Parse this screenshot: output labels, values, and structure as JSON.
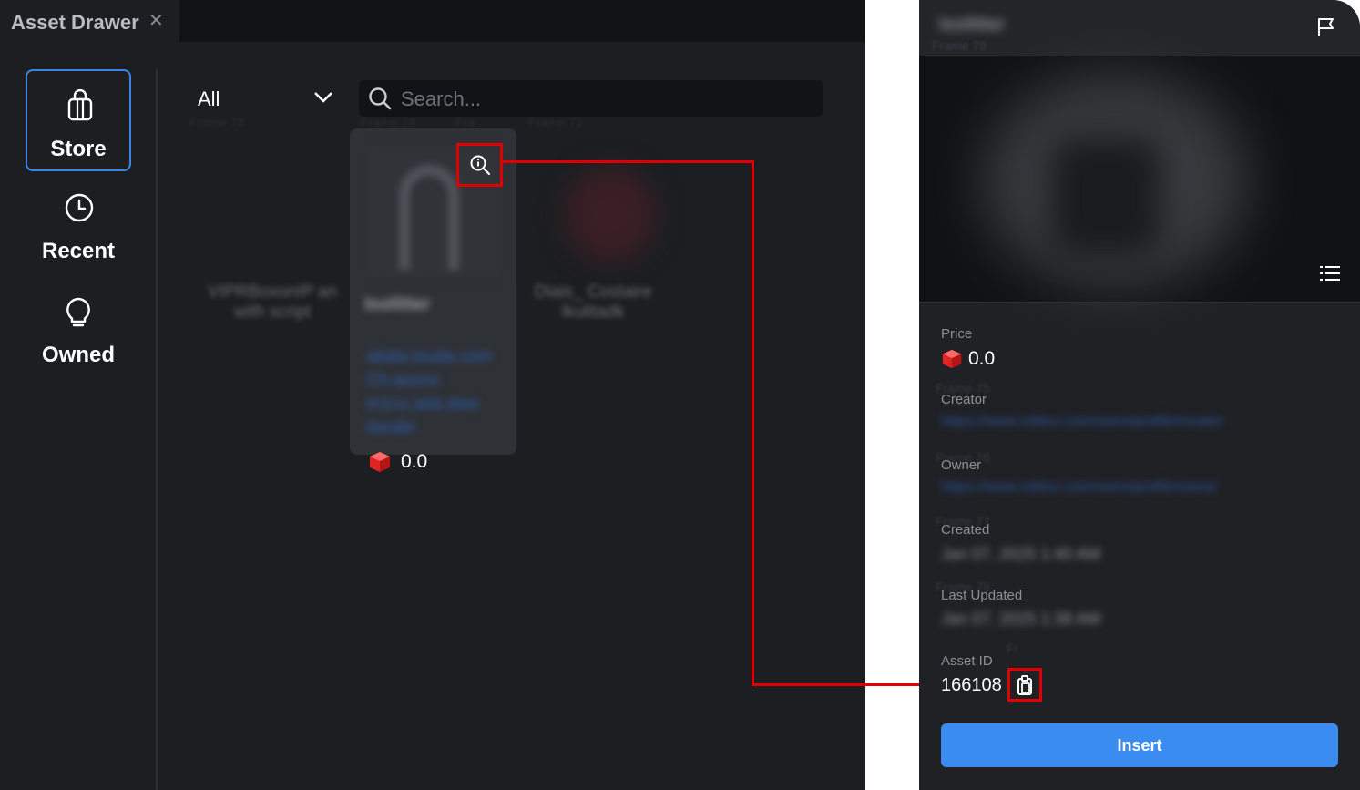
{
  "tab": {
    "title": "Asset Drawer",
    "close_glyph": "✕"
  },
  "nav": [
    {
      "label": "Store",
      "icon": "bag-icon",
      "active": true
    },
    {
      "label": "Recent",
      "icon": "clock-icon"
    },
    {
      "label": "Owned",
      "icon": "lightbulb-icon"
    }
  ],
  "filter": {
    "label": "All"
  },
  "search": {
    "placeholder": "Search..."
  },
  "ghost_labels": [
    "Frame 73",
    "Frame 74",
    "Fra",
    "Frame 72",
    "Frame 79",
    "Frame 75",
    "Frame 76",
    "Frame 77",
    "Frame 78",
    "Fr"
  ],
  "cards": [
    {
      "name_blurred": "VIPRBoxonIP an with script"
    },
    {
      "name_blurred": "Isolitter",
      "desc_blurred": "aliata.louda.com  Ch.aocnx  m1cu.ada.daw  darabi",
      "price": "0.0"
    },
    {
      "name_blurred": "Diais_ Costaire lkulitadk"
    }
  ],
  "detail": {
    "title_blurred": "Isolitter",
    "price_label": "Price",
    "price_value": "0.0",
    "creator_label": "Creator",
    "creator_blurred": "https://www.roblox.com/users/profile/creator",
    "owner_label": "Owner",
    "owner_blurred": "https://www.roblox.com/users/profile/owner",
    "created_label": "Created",
    "created_blurred": "Jan 07, 2025 1:40 AM",
    "updated_label": "Last Updated",
    "updated_blurred": "Jan 07, 2025 1:38 AM",
    "asset_id_label": "Asset ID",
    "asset_id_value": "166108",
    "insert_label": "Insert"
  },
  "colors": {
    "accent": "#3b84e6",
    "insert": "#3b8cf0",
    "highlight": "#e00000",
    "robux": "#e02424"
  }
}
